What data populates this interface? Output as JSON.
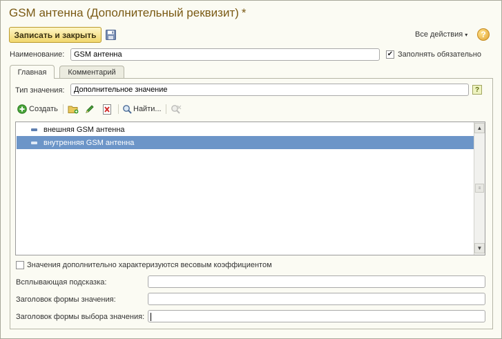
{
  "window": {
    "title": "GSM антенна (Дополнительный реквизит)",
    "modified_mark": "*"
  },
  "command_bar": {
    "save_close_label": "Записать и закрыть",
    "save_icon": "save-disk-icon",
    "all_actions_label": "Все действия",
    "all_actions_caret": "▾",
    "help_label": "?"
  },
  "name_field": {
    "label": "Наименование:",
    "value": "GSM антенна"
  },
  "required_checkbox": {
    "checked_mark": "✔",
    "label": "Заполнять обязательно"
  },
  "tabs": [
    {
      "label": "Главная"
    },
    {
      "label": "Комментарий"
    }
  ],
  "value_type": {
    "label": "Тип значения:",
    "value": "Дополнительное значение",
    "help_label": "?"
  },
  "values_toolbar": {
    "create_label": "Создать",
    "find_label": "Найти...",
    "icons": [
      "create-plus-icon",
      "add-folder-icon",
      "edit-pencil-icon",
      "delete-icon",
      "search-icon",
      "cancel-search-icon"
    ]
  },
  "values_list": {
    "rows": [
      {
        "label": "внешняя GSM антенна",
        "selected": false
      },
      {
        "label": "внутренняя GSM антенна",
        "selected": true
      }
    ]
  },
  "weight_checkbox": {
    "label": "Значения дополнительно характеризуются весовым коэффициентом"
  },
  "fields": {
    "tooltip_label": "Всплывающая подсказка:",
    "value_form_title_label": "Заголовок формы значения:",
    "choice_form_title_label": "Заголовок формы выбора значения:"
  },
  "colors": {
    "title": "#7a5a14",
    "accent_button": "#f1d76d",
    "selection": "#6c95c8",
    "background": "#fbfbf3"
  }
}
